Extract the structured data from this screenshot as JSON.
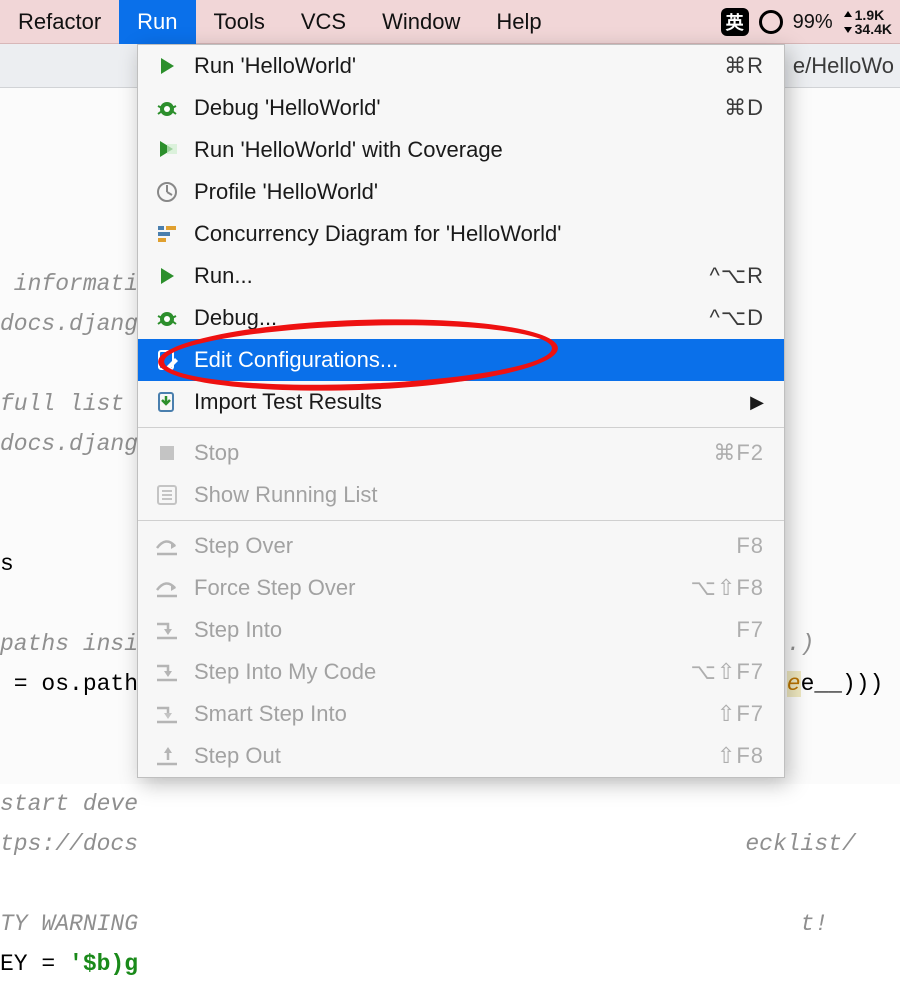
{
  "menubar": {
    "items": [
      "Refactor",
      "Run",
      "Tools",
      "VCS",
      "Window",
      "Help"
    ],
    "active_index": 1,
    "ime_label": "英",
    "battery": "99%",
    "rate_up": "1.9K",
    "rate_down": "34.4K"
  },
  "toolbar": {
    "breadcrumb_fragment": "e/HelloWo"
  },
  "editor": {
    "l1a": " informati",
    "l1b": "docs.djang",
    "l2a": "full list ",
    "l2b": "docs.djang",
    "l3a": "s",
    "l4a": "paths insi",
    "l4b_pre": " = os.path",
    "l4c_tail": "R, ...)",
    "l4d_tail": "e__)))",
    "l5a": "start deve",
    "l5b": "tps://docs",
    "l5c_tail": "ecklist/",
    "l6a": "TY WARNING",
    "l6b_pre": "EY = ",
    "l6b_str": "'$b)g",
    "l6c_tail": "t!"
  },
  "menu": {
    "items": [
      {
        "icon": "play",
        "label": "Run 'HelloWorld'",
        "shortcut": "⌘R"
      },
      {
        "icon": "bug",
        "label": "Debug 'HelloWorld'",
        "shortcut": "⌘D"
      },
      {
        "icon": "coverage",
        "label": "Run 'HelloWorld' with Coverage",
        "shortcut": ""
      },
      {
        "icon": "profile",
        "label": "Profile 'HelloWorld'",
        "shortcut": ""
      },
      {
        "icon": "concurrency",
        "label": "Concurrency Diagram for  'HelloWorld'",
        "shortcut": ""
      },
      {
        "icon": "play",
        "label": "Run...",
        "shortcut": "^⌥R"
      },
      {
        "icon": "bug",
        "label": "Debug...",
        "shortcut": "^⌥D"
      },
      {
        "icon": "edit",
        "label": "Edit Configurations...",
        "shortcut": "",
        "selected": true
      },
      {
        "icon": "import",
        "label": "Import Test Results",
        "shortcut": "",
        "submenu": true
      },
      {
        "sep": true
      },
      {
        "icon": "stop",
        "label": "Stop",
        "shortcut": "⌘F2",
        "disabled": true
      },
      {
        "icon": "list",
        "label": "Show Running List",
        "shortcut": "",
        "disabled": true
      },
      {
        "sep": true
      },
      {
        "icon": "stepover",
        "label": "Step Over",
        "shortcut": "F8",
        "disabled": true
      },
      {
        "icon": "stepover",
        "label": "Force Step Over",
        "shortcut": "⌥⇧F8",
        "disabled": true
      },
      {
        "icon": "stepinto",
        "label": "Step Into",
        "shortcut": "F7",
        "disabled": true
      },
      {
        "icon": "stepinto",
        "label": "Step Into My Code",
        "shortcut": "⌥⇧F7",
        "disabled": true
      },
      {
        "icon": "smartstep",
        "label": "Smart Step Into",
        "shortcut": "⇧F7",
        "disabled": true
      },
      {
        "icon": "stepout",
        "label": "Step Out",
        "shortcut": "⇧F8",
        "disabled": true
      }
    ]
  }
}
